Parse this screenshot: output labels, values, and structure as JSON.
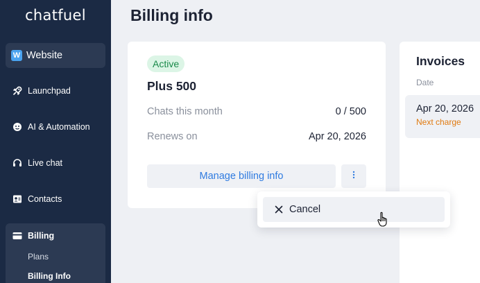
{
  "app": {
    "logo": "chatfuel"
  },
  "workspace": {
    "badge": "W",
    "name": "Website"
  },
  "sidebar": {
    "items": [
      {
        "label": "Launchpad",
        "icon": "rocket-icon"
      },
      {
        "label": "AI & Automation",
        "icon": "ai-face-icon"
      },
      {
        "label": "Live chat",
        "icon": "headset-icon"
      },
      {
        "label": "Contacts",
        "icon": "contacts-icon"
      }
    ],
    "billing": {
      "label": "Billing",
      "icon": "credit-card-icon",
      "sub_items": [
        {
          "label": "Plans"
        },
        {
          "label": "Billing Info"
        }
      ]
    }
  },
  "page": {
    "title": "Billing info"
  },
  "plan": {
    "status": "Active",
    "name": "Plus 500",
    "chats_label": "Chats this month",
    "chats_value": "0 / 500",
    "renews_label": "Renews on",
    "renews_value": "Apr 20, 2026",
    "manage_label": "Manage billing info"
  },
  "invoices": {
    "title": "Invoices",
    "col_date": "Date",
    "rows": [
      {
        "date": "Apr 20, 2026",
        "note": "Next charge"
      }
    ]
  },
  "dropdown": {
    "cancel_label": "Cancel"
  },
  "colors": {
    "sidebar_bg": "#1b2a44",
    "accent_blue": "#2f7be0",
    "active_green": "#1a8a4a",
    "next_charge_orange": "#e07a10"
  }
}
